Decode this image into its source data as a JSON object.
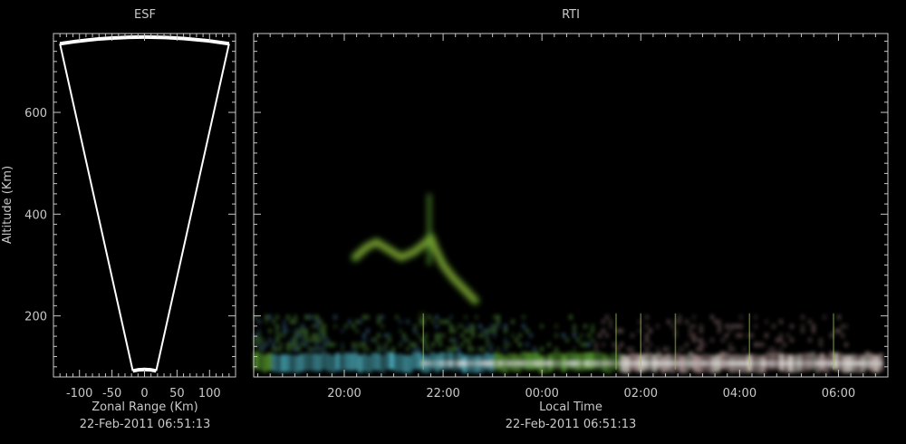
{
  "colors": {
    "background": "#000000",
    "axis": "#c8c8c8",
    "fan_outline": "#ffffff",
    "echo_green": "#5aa02e",
    "echo_cyan": "#4fb7c8",
    "echo_pink": "#b99a9a"
  },
  "chart_data": [
    {
      "type": "other",
      "title": "ESF",
      "xlabel": "Zonal Range (Km)",
      "ylabel": "Altitude (Km)",
      "date_text": "22-Feb-2011 06:51:13",
      "xlim": [
        -140,
        140
      ],
      "ylim": [
        80,
        755
      ],
      "x_ticks": [
        -100,
        -50,
        0,
        50,
        100
      ],
      "x_tick_labels": [
        "-100",
        "-50",
        "0",
        "50",
        "100"
      ],
      "y_ticks": [
        200,
        400,
        600
      ],
      "y_tick_labels": [
        "200",
        "400",
        "600"
      ],
      "fan": {
        "outer_left": [
          -130,
          735
        ],
        "outer_top": [
          0,
          748
        ],
        "outer_right": [
          130,
          735
        ],
        "inner_left": [
          -18,
          92
        ],
        "inner_right": [
          18,
          92
        ]
      }
    },
    {
      "type": "heatmap",
      "title": "RTI",
      "xlabel": "Local Time",
      "ylabel": "",
      "date_text": "22-Feb-2011 06:51:13",
      "xlim": [
        "18:10",
        "07:00"
      ],
      "ylim": [
        80,
        755
      ],
      "x_ticks": [
        "20:00",
        "22:00",
        "00:00",
        "02:00",
        "04:00",
        "06:00"
      ],
      "y_ticks": [
        200,
        400,
        600
      ],
      "echoes": [
        {
          "name": "E-region band",
          "start": "18:10",
          "end": "06:50",
          "alt_min": 95,
          "alt_max": 130
        },
        {
          "name": "low-altitude clutter",
          "start": "18:10",
          "end": "06:10",
          "alt_min": 130,
          "alt_max": 200
        },
        {
          "name": "F-region plume",
          "start": "20:15",
          "end": "22:45",
          "alt_min": 220,
          "alt_max": 440
        }
      ]
    }
  ]
}
